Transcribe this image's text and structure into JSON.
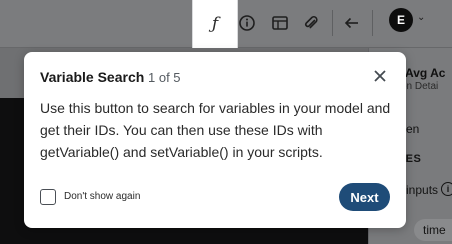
{
  "toolbar": {
    "function_glyph": "ƒ",
    "icons": [
      "info-icon",
      "layout-icon",
      "paperclip-icon",
      "arrow-left-icon"
    ],
    "avatar_initial": "E",
    "avatar_caret": "⌄"
  },
  "side_panel": {
    "title": "Avg Ac",
    "subtitle": "tion Detai",
    "environment": "ironmen",
    "variables_heading": "IABLES",
    "inputs_label": "inputs",
    "chip_label": "time"
  },
  "popover": {
    "title": "Variable Search",
    "step": "1 of 5",
    "body": "Use this button to search for variables in your model and get their IDs. You can then use these IDs with getVariable() and setVariable() in your scripts.",
    "checkbox_label": "Don't show again",
    "checkbox_checked": false,
    "next_label": "Next"
  },
  "colors": {
    "accent": "#1f4c78",
    "overlay": "#6f7072"
  }
}
